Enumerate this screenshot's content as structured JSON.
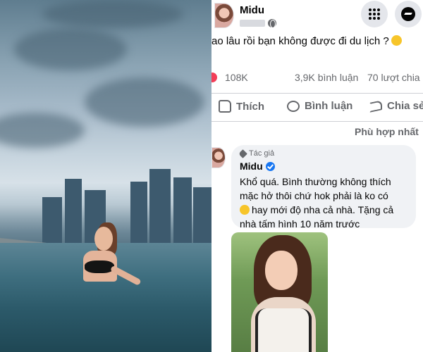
{
  "post": {
    "author": "Midu",
    "text": "ao lâu rồi bạn không được đi du lịch ?",
    "reactions_count": "108K",
    "comments_count": "3,9K bình luận",
    "shares_count": "70 lượt chia",
    "actions": {
      "like": "Thích",
      "comment": "Bình luận",
      "share": "Chia sẻ"
    }
  },
  "comments": {
    "sort_label": "Phù hợp nhất",
    "items": [
      {
        "badge": "Tác giả",
        "author": "Midu",
        "lines": [
          "Khổ quá. Bình thường không thích",
          "mặc hở thôi chứ hok phải là ko có",
          "hay mới độ nha cả nhà. Tặng cả",
          "nhà tấm hình 10 năm trước"
        ]
      }
    ]
  },
  "icons": {
    "menu": "grid-menu-icon",
    "messenger": "messenger-icon",
    "privacy": "globe-icon",
    "reaction": "heart-icon",
    "like": "like-icon",
    "comment": "comment-icon",
    "share": "share-icon",
    "verified": "verified-icon",
    "author_badge": "pen-icon"
  },
  "colors": {
    "accent": "#1877f2",
    "reaction": "#f33e58",
    "secondary_text": "#65676b",
    "bubble": "#f0f2f5"
  }
}
